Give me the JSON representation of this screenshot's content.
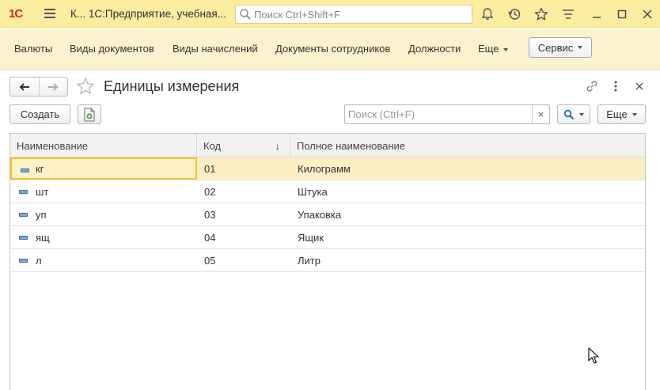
{
  "titlebar": {
    "logo": "1С",
    "app_title": "К... 1С:Предприятие, учебная...",
    "search_placeholder": "Поиск Ctrl+Shift+F"
  },
  "sections": {
    "items": [
      {
        "label": "Валюты"
      },
      {
        "label": "Виды документов"
      },
      {
        "label": "Виды начислений"
      },
      {
        "label": "Документы сотрудников"
      },
      {
        "label": "Должности"
      },
      {
        "label": "Еще"
      }
    ],
    "service_label": "Сервис"
  },
  "form": {
    "title": "Единицы измерения",
    "create_label": "Создать",
    "search_placeholder": "Поиск (Ctrl+F)",
    "clear_label": "×",
    "more_label": "Еще"
  },
  "table": {
    "columns": [
      "Наименование",
      "Код",
      "Полное наименование"
    ],
    "sort_indicator": "↓",
    "rows": [
      {
        "name": "кг",
        "code": "01",
        "full": "Килограмм",
        "selected": true
      },
      {
        "name": "шт",
        "code": "02",
        "full": "Штука",
        "selected": false
      },
      {
        "name": "уп",
        "code": "03",
        "full": "Упаковка",
        "selected": false
      },
      {
        "name": "ящ",
        "code": "04",
        "full": "Ящик",
        "selected": false
      },
      {
        "name": "л",
        "code": "05",
        "full": "Литр",
        "selected": false
      }
    ]
  },
  "colors": {
    "titlebar_bg": "#fbeda0",
    "sections_bg": "#fbf3cd",
    "selected_row": "#fcefc4",
    "selected_cell_border": "#f2c12e",
    "logo_red": "#d42b1e"
  }
}
